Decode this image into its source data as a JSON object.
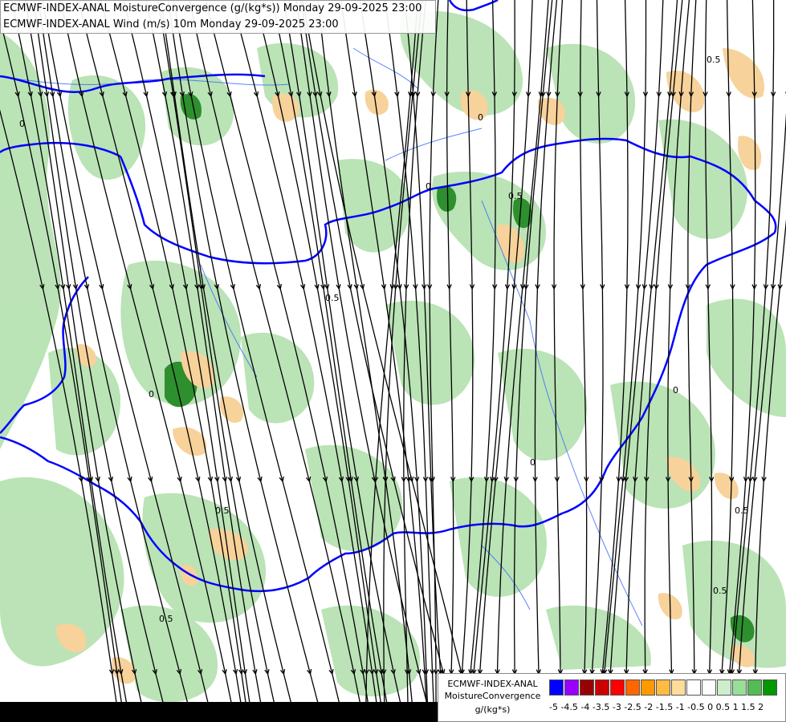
{
  "header": {
    "line1": "ECMWF-INDEX-ANAL MoistureConvergence (g/(kg*s)) Monday 29-09-2025 23:00",
    "line2": "ECMWF-INDEX-ANAL Wind (m/s) 10m Monday 29-09-2025 23:00"
  },
  "legend": {
    "line1": "ECMWF-INDEX-ANAL",
    "line2": "MoistureConvergence",
    "line3": "g/(kg*s)",
    "ticks": "-5 -4.5 -4 -3.5 -3 -2.5 -2 -1.5 -1 -0.5 0 0.5 1 1.5 2",
    "colors": [
      "#0000ff",
      "#9900ff",
      "#990000",
      "#cc0000",
      "#ff0000",
      "#ff6600",
      "#ff9900",
      "#ffbb44",
      "#ffdd99",
      "#ffffff",
      "#ffffff",
      "#cceecc",
      "#99dd99",
      "#55bb55",
      "#009900"
    ]
  },
  "map": {
    "contour_labels": [
      "0",
      "0",
      "0",
      "0.5",
      "0.5",
      "0.5",
      "0.5",
      "0.5",
      "0",
      "0",
      "0.5",
      "0.5",
      "0"
    ],
    "colors": {
      "convergence": "#b7e2b3",
      "strong_convergence": "#2e8f2e",
      "divergence": "#f7d29a",
      "border": "#0000ff",
      "river": "#3366ff",
      "streamline": "#000000"
    }
  }
}
